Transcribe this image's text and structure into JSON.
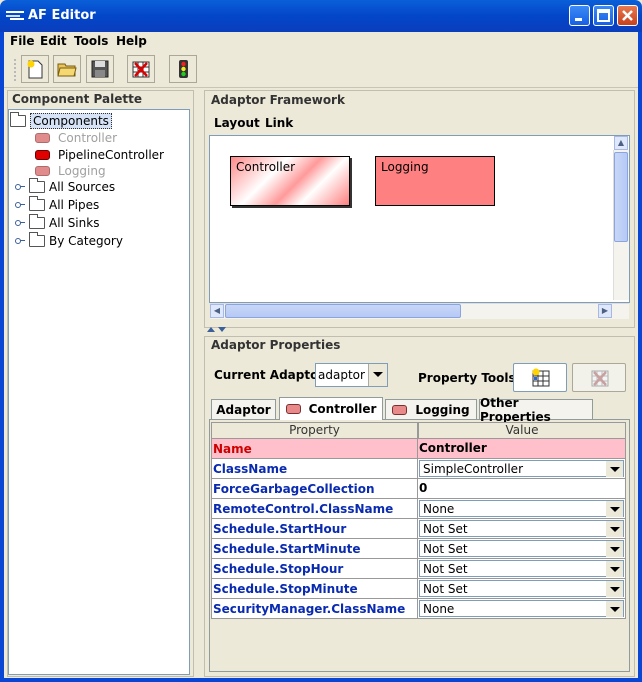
{
  "window": {
    "title": "AF Editor"
  },
  "menubar": {
    "items": [
      "File",
      "Edit",
      "Tools",
      "Help"
    ]
  },
  "toolbar": {
    "buttons": [
      "new-icon",
      "open-folder-icon",
      "save-icon",
      "delete-grid-icon",
      "traffic-light-icon"
    ]
  },
  "palette": {
    "title": "Component Palette",
    "root": "Components",
    "items": [
      {
        "label": "Controller",
        "enabled": false
      },
      {
        "label": "PipelineController",
        "enabled": true
      },
      {
        "label": "Logging",
        "enabled": false
      }
    ],
    "folders": [
      "All Sources",
      "All Pipes",
      "All Sinks",
      "By Category"
    ]
  },
  "framework": {
    "title": "Adaptor Framework",
    "menu": [
      "Layout",
      "Link"
    ],
    "nodes": [
      "Controller",
      "Logging"
    ]
  },
  "properties": {
    "title": "Adaptor Properties",
    "current_adaptor_label": "Current Adaptor:",
    "current_adaptor_value": "adaptor",
    "property_tools_label": "Property Tools:",
    "tabs": [
      "Adaptor",
      "Controller",
      "Logging",
      "Other Properties"
    ],
    "table": {
      "headers": [
        "Property",
        "Value"
      ],
      "rows": [
        {
          "name": "Name",
          "value": "Controller"
        },
        {
          "name": "ClassName",
          "value": "SimpleController"
        },
        {
          "name": "ForceGarbageCollection",
          "value": "0"
        },
        {
          "name": "RemoteControl.ClassName",
          "value": "None"
        },
        {
          "name": "Schedule.StartHour",
          "value": "Not Set"
        },
        {
          "name": "Schedule.StartMinute",
          "value": "Not Set"
        },
        {
          "name": "Schedule.StopHour",
          "value": "Not Set"
        },
        {
          "name": "Schedule.StopMinute",
          "value": "Not Set"
        },
        {
          "name": "SecurityManager.ClassName",
          "value": "None"
        }
      ]
    }
  },
  "colors": {
    "titlebar": "#0a5fd8",
    "node_fill": "#ff8080",
    "name_row": "#ffc0cb",
    "property_text": "#0a2bb0"
  }
}
